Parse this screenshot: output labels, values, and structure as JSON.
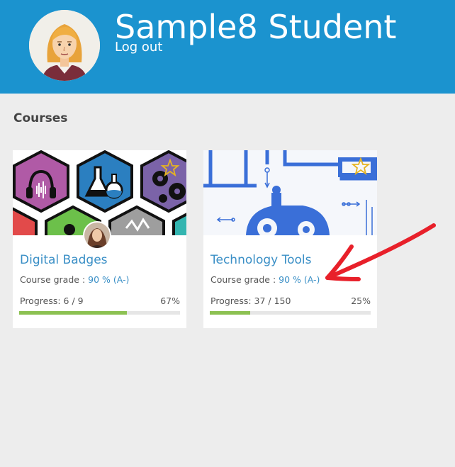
{
  "header": {
    "user_name": "Sample8 Student",
    "logout_label": "Log out",
    "background_color": "#1b93cf"
  },
  "courses_heading": "Courses",
  "courses": [
    {
      "title": "Digital Badges",
      "grade_label": "Course grade : ",
      "grade_value": "90 % (A-)",
      "progress_label": "Progress: 6 / 9",
      "progress_percent_text": "67%",
      "progress_fraction": 0.67,
      "image_icon": "badge-hexagons-image",
      "teacher_avatar_icon": "teacher-avatar"
    },
    {
      "title": "Technology Tools",
      "grade_label": "Course grade : ",
      "grade_value": "90 % (A-)",
      "progress_label": "Progress: 37 / 150",
      "progress_percent_text": "25%",
      "progress_fraction": 0.25,
      "image_icon": "gears-circuit-image"
    }
  ],
  "colors": {
    "link": "#3a8fc6",
    "progress_fill": "#8cc152",
    "annotation_arrow": "#e8202a"
  }
}
